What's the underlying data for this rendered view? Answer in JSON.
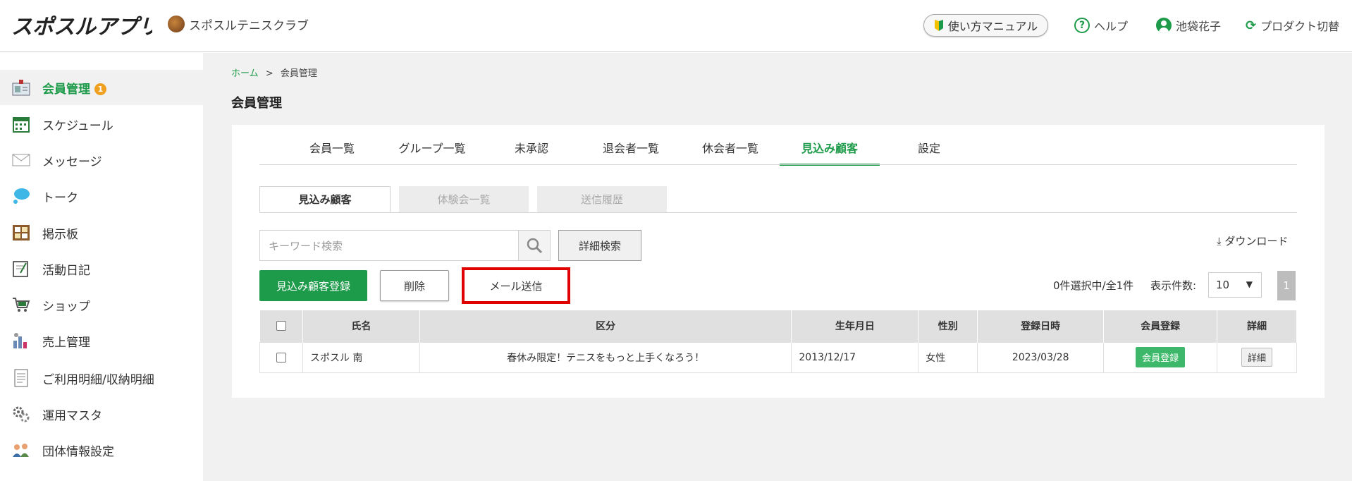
{
  "header": {
    "logo_text": "スポスルアプリ",
    "club_name": "スポスルテニスクラブ",
    "manual_label": "使い方マニュアル",
    "help_label": "ヘルプ",
    "user_name": "池袋花子",
    "product_switch_label": "プロダクト切替"
  },
  "sidebar": {
    "items": [
      {
        "label": "会員管理",
        "icon": "members-icon",
        "badge": "1",
        "active": true
      },
      {
        "label": "スケジュール",
        "icon": "calendar-icon"
      },
      {
        "label": "メッセージ",
        "icon": "mail-icon"
      },
      {
        "label": "トーク",
        "icon": "chat-icon"
      },
      {
        "label": "掲示板",
        "icon": "board-icon"
      },
      {
        "label": "活動日記",
        "icon": "diary-icon"
      },
      {
        "label": "ショップ",
        "icon": "cart-icon"
      },
      {
        "label": "売上管理",
        "icon": "sales-icon"
      },
      {
        "label": "ご利用明細/収納明細",
        "icon": "statement-icon"
      },
      {
        "label": "運用マスタ",
        "icon": "settings-icon"
      },
      {
        "label": "団体情報設定",
        "icon": "organization-icon"
      }
    ]
  },
  "breadcrumb": {
    "home": "ホーム",
    "sep": ">",
    "current": "会員管理"
  },
  "page_title": "会員管理",
  "tabs": [
    "会員一覧",
    "グループ一覧",
    "未承認",
    "退会者一覧",
    "休会者一覧",
    "見込み顧客",
    "設定"
  ],
  "active_tab": "見込み顧客",
  "subtabs": [
    "見込み顧客",
    "体験会一覧",
    "送信履歴"
  ],
  "search": {
    "placeholder": "キーワード検索",
    "advanced_label": "詳細検索"
  },
  "download_label": "ダウンロード",
  "actions": {
    "register": "見込み顧客登録",
    "delete": "削除",
    "send_mail": "メール送信"
  },
  "pagination": {
    "count_text": "0件選択中/全1件",
    "per_page_label": "表示件数:",
    "per_page_value": "10",
    "current_page": "1"
  },
  "table": {
    "headers": [
      "氏名",
      "区分",
      "生年月日",
      "性別",
      "登録日時",
      "会員登録",
      "詳細"
    ],
    "rows": [
      {
        "name": "スポスル 南",
        "category": "春休み限定！テニスをもっと上手くなろう！",
        "birthdate": "2013/12/17",
        "gender": "女性",
        "registered": "2023/03/28",
        "register_btn": "会員登録",
        "detail_btn": "詳細"
      }
    ]
  },
  "colors": {
    "accent": "#1e9b4a",
    "badge": "#f0a020",
    "highlight": "#e00000"
  }
}
